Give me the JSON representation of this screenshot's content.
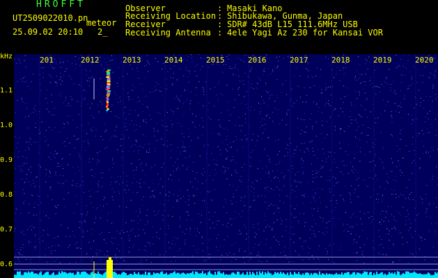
{
  "header": {
    "app_name": "HROFFT",
    "file_name": "UT2509022010.pn",
    "file_suffix": "meteor",
    "timestamp": "25.09.02 20:10",
    "counter": "2_",
    "fields": [
      {
        "label": "Observer",
        "sep": ":",
        "value": "Masaki Kano"
      },
      {
        "label": "Receiving Location",
        "sep": ":",
        "value": "Shibukawa, Gunma, Japan"
      },
      {
        "label": "Receiver",
        "sep": ":",
        "value": "SDR# 43dB L15 111.6MHz USB"
      },
      {
        "label": "Receiving Antenna",
        "sep": ":",
        "value": "4ele Yagi Az 230 for Kansai VOR"
      }
    ]
  },
  "spectrogram": {
    "unit": "kHz",
    "y_ticks": [
      "1.1",
      "1.0",
      "0.9",
      "0.8",
      "0.7",
      "0.6"
    ],
    "x_ticks": [
      "201",
      "2012",
      "2013",
      "2014",
      "2015",
      "2016",
      "2017",
      "2018",
      "2019",
      "2020"
    ],
    "colors": {
      "background": "#00005a",
      "noise": "#3a4cff",
      "baseline": "#00e5ff",
      "signal": "#ffff00"
    }
  }
}
